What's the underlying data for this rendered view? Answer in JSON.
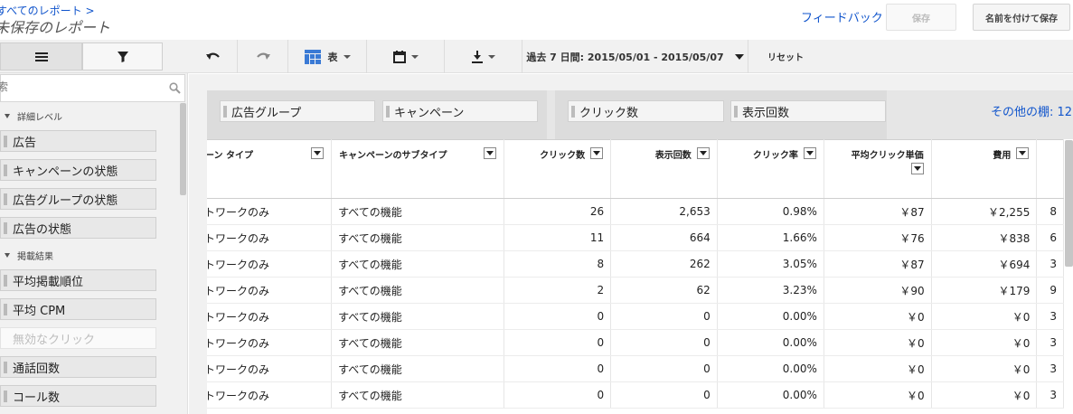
{
  "header": {
    "breadcrumb": "すべてのレポート >",
    "title": "未保存のレポート",
    "feedback": "フィードバック",
    "save": "保存",
    "save_as": "名前を付けて保存"
  },
  "toolbar": {
    "view_label": "表",
    "date_range": "過去 7 日間: 2015/05/01 - 2015/05/07",
    "reset": "リセット"
  },
  "left_panel": {
    "search_placeholder": "索",
    "sections": [
      {
        "title": "詳細レベル",
        "items": [
          "広告",
          "キャンペーンの状態",
          "広告グループの状態",
          "広告の状態"
        ]
      },
      {
        "title": "掲載結果",
        "items": [
          "平均掲載順位",
          "平均 CPM",
          "無効なクリック",
          "通話回数",
          "コール数"
        ]
      }
    ]
  },
  "pivot": {
    "rows": [
      "広告グループ",
      "キャンペーン"
    ],
    "columns": [
      "クリック数",
      "表示回数"
    ],
    "more_shelves": "その他の棚: 12"
  },
  "table": {
    "headers": [
      "ーン タイプ",
      "キャンペーンのサブタイプ",
      "クリック数",
      "表示回数",
      "クリック率",
      "平均クリック単価",
      "費用"
    ],
    "rows": [
      [
        "トワークのみ",
        "すべての機能",
        "26",
        "2,653",
        "0.98%",
        "￥87",
        "￥2,255",
        "8"
      ],
      [
        "トワークのみ",
        "すべての機能",
        "11",
        "664",
        "1.66%",
        "￥76",
        "￥838",
        "6"
      ],
      [
        "トワークのみ",
        "すべての機能",
        "8",
        "262",
        "3.05%",
        "￥87",
        "￥694",
        "3"
      ],
      [
        "トワークのみ",
        "すべての機能",
        "2",
        "62",
        "3.23%",
        "￥90",
        "￥179",
        "9"
      ],
      [
        "トワークのみ",
        "すべての機能",
        "0",
        "0",
        "0.00%",
        "￥0",
        "￥0",
        "3"
      ],
      [
        "トワークのみ",
        "すべての機能",
        "0",
        "0",
        "0.00%",
        "￥0",
        "￥0",
        "3"
      ],
      [
        "トワークのみ",
        "すべての機能",
        "0",
        "0",
        "0.00%",
        "￥0",
        "￥0",
        "3"
      ],
      [
        "トワークのみ",
        "すべての機能",
        "0",
        "0",
        "0.00%",
        "￥0",
        "￥0",
        "3"
      ]
    ]
  }
}
